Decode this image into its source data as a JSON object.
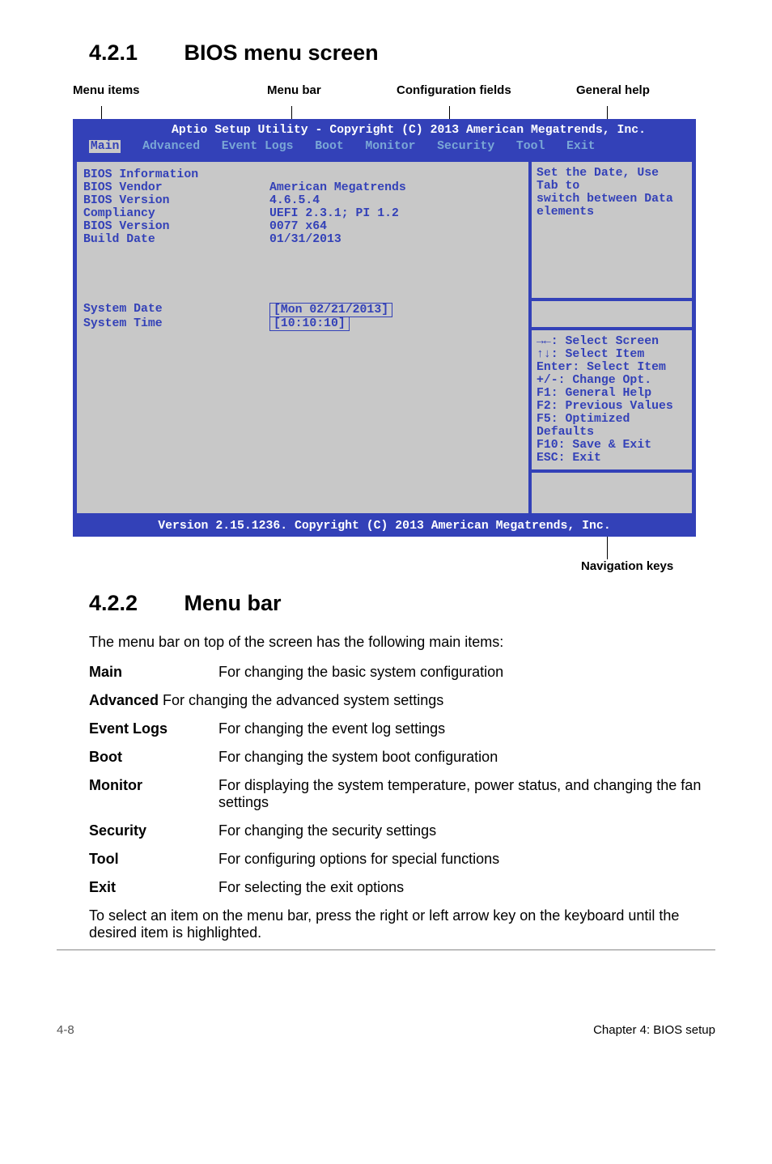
{
  "sections": {
    "s1": {
      "num": "4.2.1",
      "title": "BIOS menu screen"
    },
    "s2": {
      "num": "4.2.2",
      "title": "Menu bar"
    }
  },
  "diagram_labels": {
    "menu_items": "Menu items",
    "menu_bar": "Menu bar",
    "config_fields": "Configuration fields",
    "general_help": "General help",
    "nav_keys": "Navigation keys"
  },
  "bios": {
    "header_line": "Aptio Setup Utility - Copyright (C) 2013 American Megatrends, Inc.",
    "tabs": {
      "main": "Main",
      "advanced": "Advanced",
      "eventlogs": "Event Logs",
      "boot": "Boot",
      "monitor": "Monitor",
      "security": "Security",
      "tool": "Tool",
      "exit": "Exit"
    },
    "info": {
      "title": "BIOS Information",
      "rows": {
        "vendor": {
          "k": "BIOS Vendor",
          "v": "American Megatrends"
        },
        "version": {
          "k": "BIOS Version",
          "v": "4.6.5.4"
        },
        "compl": {
          "k": "Compliancy",
          "v": "UEFI 2.3.1; PI 1.2"
        },
        "bver": {
          "k": "BIOS Version",
          "v": "0077 x64"
        },
        "bdate": {
          "k": "Build Date",
          "v": "01/31/2013"
        }
      }
    },
    "fields": {
      "date": {
        "k": "System Date",
        "v": "[Mon 02/21/2013]"
      },
      "time": {
        "k": "System Time",
        "v": "[10:10:10]"
      }
    },
    "help": {
      "l1": "Set the Date, Use Tab to",
      "l2": "switch between Data elements"
    },
    "nav": {
      "l1": "→←: Select Screen",
      "l2": "↑↓:  Select Item",
      "l3": "Enter: Select Item",
      "l4": "+/-: Change Opt.",
      "l5": "F1: General Help",
      "l6": "F2: Previous Values",
      "l7": "F5: Optimized Defaults",
      "l8": "F10: Save & Exit",
      "l9": "ESC: Exit"
    },
    "footer": "Version 2.15.1236. Copyright (C) 2013 American Megatrends, Inc."
  },
  "menubar": {
    "intro": "The menu bar on top of the screen has the following main items:",
    "rows": {
      "main": {
        "k": "Main",
        "v": "For changing the basic system configuration"
      },
      "advanced_combined": "Advanced For changing the advanced system settings",
      "advanced_k": "Advanced",
      "eventlogs": {
        "k": "Event Logs",
        "v": "For changing the event log settings"
      },
      "boot": {
        "k": "Boot",
        "v": "For changing the system boot configuration"
      },
      "monitor": {
        "k": "Monitor",
        "v": "For displaying the system temperature, power status, and changing the fan settings"
      },
      "security": {
        "k": "Security",
        "v": "For changing the security settings"
      },
      "tool": {
        "k": "Tool",
        "v": "For configuring options for special functions"
      },
      "exit": {
        "k": "Exit",
        "v": "For selecting the exit options"
      }
    },
    "closing": "To select an item on the menu bar, press the right or left arrow key on the keyboard until the desired item is highlighted."
  },
  "footer": {
    "page": "4-8",
    "chapter": "Chapter 4: BIOS setup"
  }
}
